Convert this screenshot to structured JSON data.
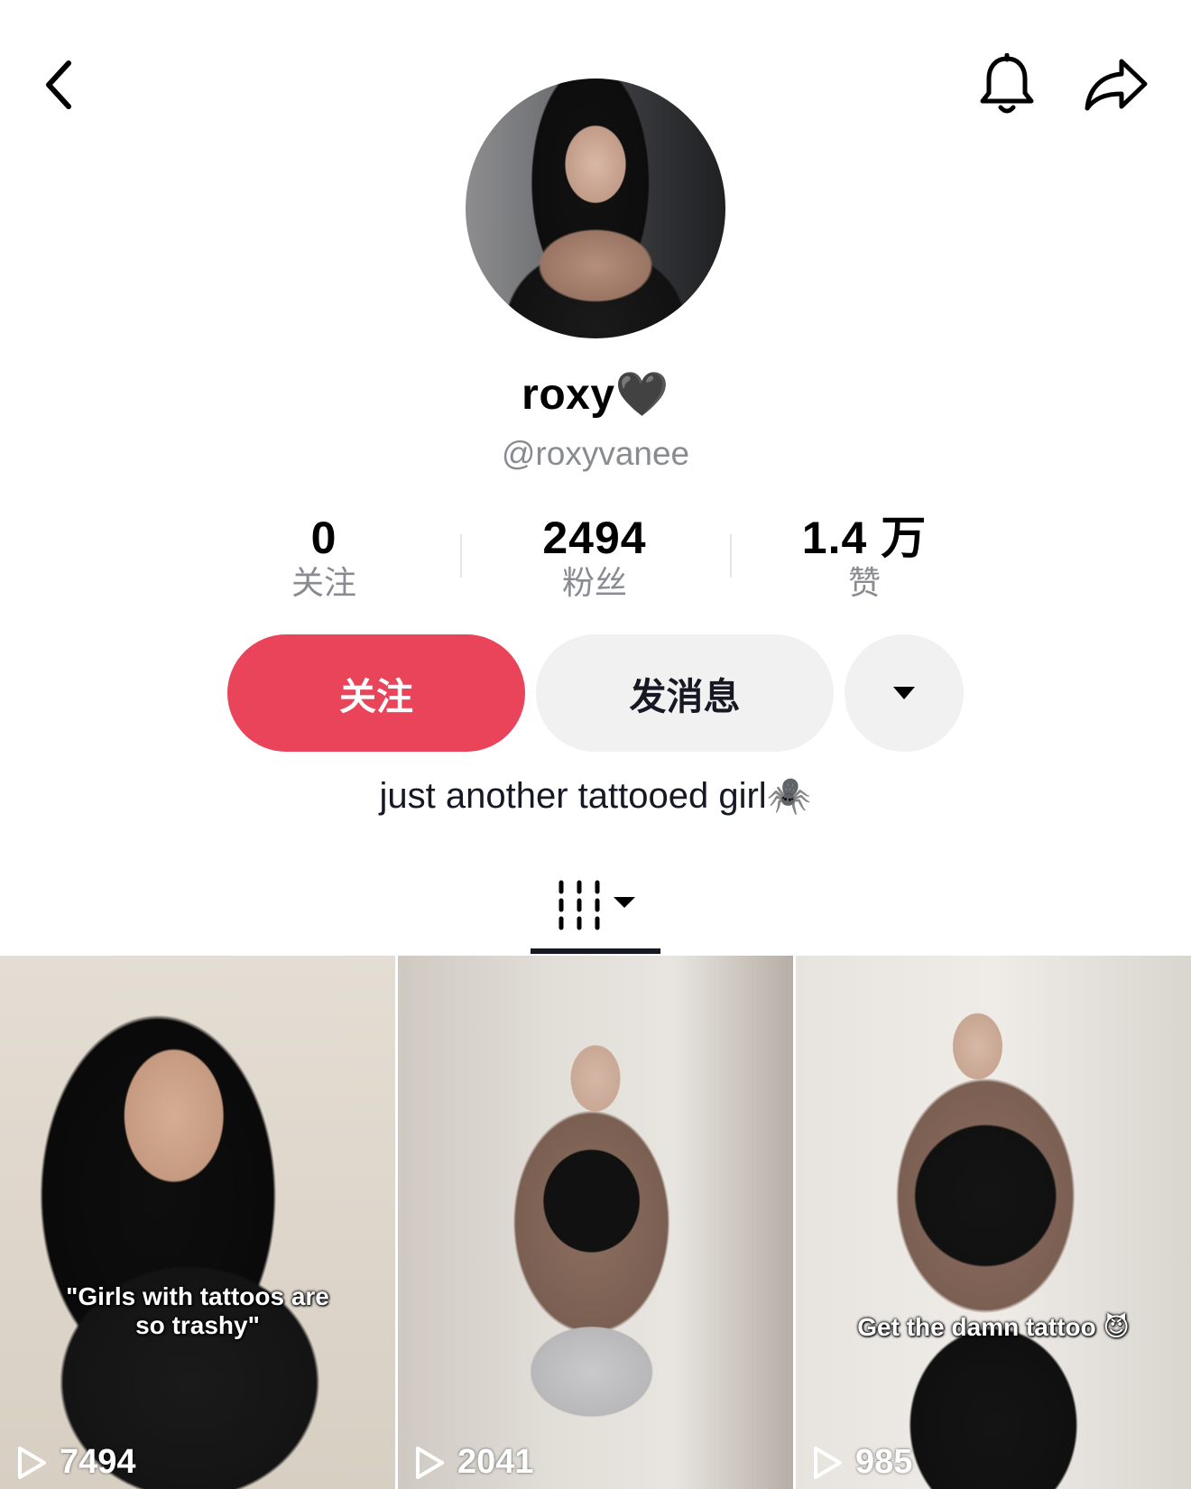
{
  "header": {
    "back_icon": "chevron-left-icon",
    "bell_icon": "bell-icon",
    "share_icon": "share-arrow-icon"
  },
  "profile": {
    "display_name": "roxy🖤",
    "username": "@roxyvanee",
    "bio": "just another tattooed girl🕷️"
  },
  "stats": [
    {
      "value": "0",
      "label": "关注"
    },
    {
      "value": "2494",
      "label": "粉丝"
    },
    {
      "value": "1.4 万",
      "label": "赞"
    }
  ],
  "actions": {
    "follow_label": "关注",
    "message_label": "发消息",
    "more_icon": "caret-down-icon"
  },
  "colors": {
    "follow_button": "#ea445a",
    "secondary_button": "#f1f1f2",
    "muted_text": "#8a8b91"
  },
  "tabs": {
    "active_icon": "videos-grid-icon"
  },
  "videos": [
    {
      "caption": "\"Girls with tattoos are so trashy\"",
      "plays": "7494"
    },
    {
      "caption": "",
      "plays": "2041"
    },
    {
      "caption": "Get the damn tattoo 😈",
      "plays": "985"
    }
  ]
}
